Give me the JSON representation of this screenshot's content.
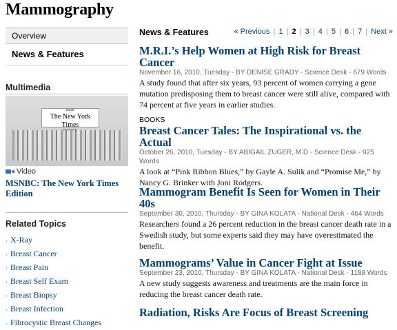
{
  "page": {
    "title": "Mammography"
  },
  "sidebar": {
    "nav": {
      "overview": "Overview",
      "features": "News & Features"
    },
    "multimedia": {
      "heading": "Multimedia",
      "thumb_small": "msnbc",
      "thumb_logo": "The New York Times",
      "thumb_edition": "EDITION",
      "video_label": "Video",
      "video_title": "MSNBC: The New York Times Edition"
    },
    "related": {
      "heading": "Related Topics",
      "items": [
        "X-Ray",
        "Breast Cancer",
        "Breast Pain",
        "Breast Self Exam",
        "Breast Biopsy",
        "Breast Infection",
        "Fibrocystic Breast Changes"
      ]
    }
  },
  "main": {
    "section_title": "News & Features",
    "pager": {
      "prev": "« Previous",
      "pages": [
        "1",
        "2",
        "3",
        "4",
        "5",
        "6",
        "7"
      ],
      "current": "2",
      "next": "Next »"
    },
    "articles": [
      {
        "kicker": "",
        "headline": "M.R.I.’s Help Women at High Risk for Breast Cancer",
        "byline": "November 16, 2010, Tuesday - BY DENISE GRADY - Science Desk - 679 Words",
        "summary": "A study found that after six years, 93 percent of women carrying a gene mutation predisposing them to breast cancer were still alive, compared with 74 percent at five years in earlier studies."
      },
      {
        "kicker": "BOOKS",
        "headline": "Breast Cancer Tales: The Inspirational vs. the Actual",
        "byline": "October 26, 2010, Tuesday - BY ABIGAIL ZUGER, M.D - Science Desk - 925 Words",
        "summary": "A look at “Pink Ribbon Blues,” by Gayle A. Sulik and “Promise Me,” by Nancy G. Brinker with Joni Rodgers."
      },
      {
        "kicker": "",
        "headline": "Mammogram Benefit Is Seen for Women in Their 40s",
        "byline": "September 30, 2010, Thursday - BY GINA KOLATA - National Desk - 464 Words",
        "summary": "Researchers found a 26 percent reduction in the breast cancer death rate in a Swedish study, but some experts said they may have overestimated the benefit."
      },
      {
        "kicker": "",
        "headline": "Mammograms’ Value in Cancer Fight at Issue",
        "byline": "September 23, 2010, Thursday - BY GINA KOLATA - National Desk - 1188 Words",
        "summary": "A new study suggests awareness and treatments are the main force in reducing the breast cancer death rate."
      },
      {
        "kicker": "",
        "headline": "Radiation, Risks Are Focus of Breast Screening",
        "byline": "",
        "summary": ""
      }
    ]
  }
}
